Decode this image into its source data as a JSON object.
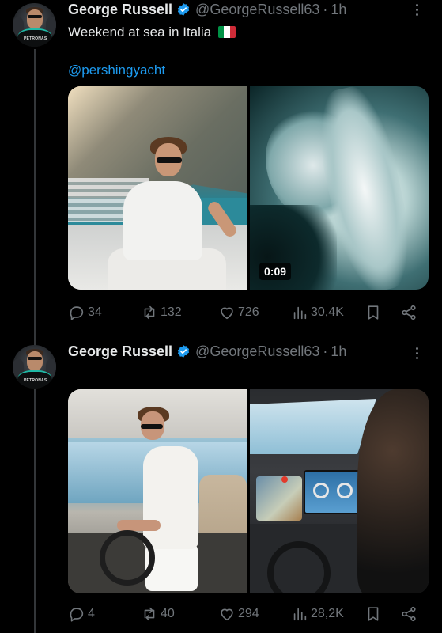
{
  "tweets": [
    {
      "author_name": "George Russell",
      "handle": "@GeorgeRussell63",
      "separator": "·",
      "time": "1h",
      "text": "Weekend at sea in Italia",
      "flag_colors": [
        "#009246",
        "#ffffff",
        "#ce2b37"
      ],
      "mention": "@pershingyacht",
      "media": [
        {
          "kind": "photo",
          "description_icon": "photo"
        },
        {
          "kind": "video",
          "duration": "0:09"
        }
      ],
      "actions": {
        "replies": "34",
        "retweets": "132",
        "likes": "726",
        "views": "30,4K"
      }
    },
    {
      "author_name": "George Russell",
      "handle": "@GeorgeRussell63",
      "separator": "·",
      "time": "1h",
      "media": [
        {
          "kind": "photo"
        },
        {
          "kind": "photo"
        }
      ],
      "actions": {
        "replies": "4",
        "retweets": "40",
        "likes": "294",
        "views": "28,2K"
      }
    }
  ],
  "avatar_badge_text": "PETRONAS",
  "colors": {
    "background": "#000000",
    "text": "#e7e9ea",
    "muted": "#71767b",
    "link": "#1d9bf0",
    "verified": "#1d9bf0"
  }
}
